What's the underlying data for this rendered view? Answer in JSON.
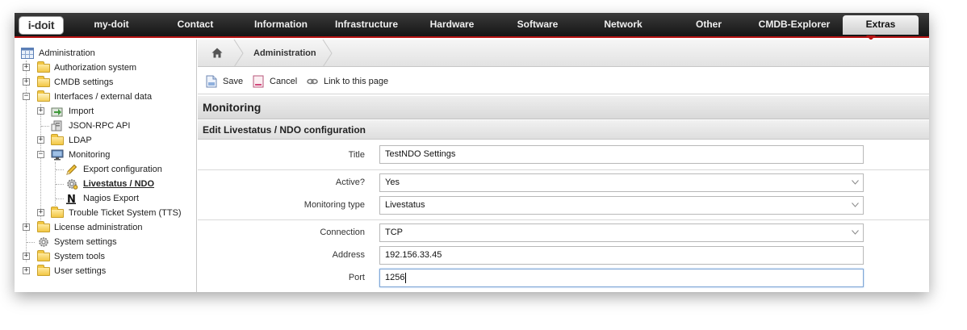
{
  "app": {
    "logo_text": "i-doit"
  },
  "topnav": {
    "items": [
      "my-doit",
      "Contact",
      "Information",
      "Infrastructure",
      "Hardware",
      "Software",
      "Network",
      "Other",
      "CMDB-Explorer",
      "Extras"
    ],
    "active": "Extras",
    "accent": "#b81414"
  },
  "tree": {
    "root": "Administration",
    "items": [
      {
        "label": "Authorization system",
        "icon": "folder-icon"
      },
      {
        "label": "CMDB settings",
        "icon": "folder-icon"
      },
      {
        "label": "Interfaces / external data",
        "icon": "folder-open-icon"
      },
      {
        "label": "Import",
        "icon": "import-icon"
      },
      {
        "label": "JSON-RPC API",
        "icon": "api-icon"
      },
      {
        "label": "LDAP",
        "icon": "folder-icon"
      },
      {
        "label": "Monitoring",
        "icon": "monitor-icon"
      },
      {
        "label": "Export configuration",
        "icon": "pencil-icon"
      },
      {
        "label": "Livestatus / NDO",
        "icon": "gear-icon"
      },
      {
        "label": "Nagios Export",
        "icon": "nagios-icon"
      },
      {
        "label": "Trouble Ticket System (TTS)",
        "icon": "folder-icon"
      },
      {
        "label": "License administration",
        "icon": "folder-icon"
      },
      {
        "label": "System settings",
        "icon": "gear-icon"
      },
      {
        "label": "System tools",
        "icon": "folder-icon"
      },
      {
        "label": "User settings",
        "icon": "folder-icon"
      }
    ],
    "selected": "Livestatus / NDO"
  },
  "breadcrumb": {
    "items": [
      "Administration"
    ]
  },
  "toolbar": {
    "save": "Save",
    "cancel": "Cancel",
    "link": "Link to this page"
  },
  "section": {
    "title": "Monitoring",
    "subtitle": "Edit Livestatus / NDO configuration"
  },
  "form": {
    "title": {
      "label": "Title",
      "value": "TestNDO Settings"
    },
    "active": {
      "label": "Active?",
      "value": "Yes"
    },
    "monitoring_type": {
      "label": "Monitoring type",
      "value": "Livestatus"
    },
    "connection": {
      "label": "Connection",
      "value": "TCP"
    },
    "address": {
      "label": "Address",
      "value": "192.156.33.45"
    },
    "port": {
      "label": "Port",
      "value": "1256"
    }
  }
}
